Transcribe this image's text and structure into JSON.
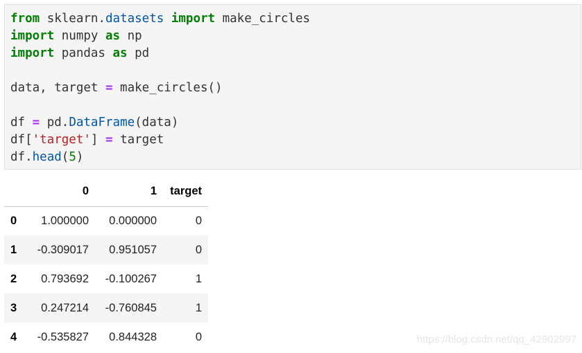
{
  "code_cell": {
    "lines": [
      [
        {
          "t": "from",
          "c": "kw"
        },
        {
          "t": " sklearn",
          "c": ""
        },
        {
          "t": ".",
          "c": ""
        },
        {
          "t": "datasets",
          "c": "nm"
        },
        {
          "t": " ",
          "c": ""
        },
        {
          "t": "import",
          "c": "kw"
        },
        {
          "t": " make_circles",
          "c": ""
        }
      ],
      [
        {
          "t": "import",
          "c": "kw"
        },
        {
          "t": " numpy ",
          "c": ""
        },
        {
          "t": "as",
          "c": "kw"
        },
        {
          "t": " np",
          "c": ""
        }
      ],
      [
        {
          "t": "import",
          "c": "kw"
        },
        {
          "t": " pandas ",
          "c": ""
        },
        {
          "t": "as",
          "c": "kw"
        },
        {
          "t": " pd",
          "c": ""
        }
      ],
      [],
      [
        {
          "t": "data, target ",
          "c": ""
        },
        {
          "t": "=",
          "c": "op"
        },
        {
          "t": " make_circles()",
          "c": ""
        }
      ],
      [],
      [
        {
          "t": "df ",
          "c": ""
        },
        {
          "t": "=",
          "c": "op"
        },
        {
          "t": " pd",
          "c": ""
        },
        {
          "t": ".",
          "c": ""
        },
        {
          "t": "DataFrame",
          "c": "nm"
        },
        {
          "t": "(data)",
          "c": ""
        }
      ],
      [
        {
          "t": "df[",
          "c": ""
        },
        {
          "t": "'target'",
          "c": "st"
        },
        {
          "t": "] ",
          "c": ""
        },
        {
          "t": "=",
          "c": "op"
        },
        {
          "t": " target",
          "c": ""
        }
      ],
      [
        {
          "t": "df",
          "c": ""
        },
        {
          "t": ".",
          "c": ""
        },
        {
          "t": "head",
          "c": "nm"
        },
        {
          "t": "(",
          "c": ""
        },
        {
          "t": "5",
          "c": "nu"
        },
        {
          "t": ")",
          "c": ""
        }
      ]
    ]
  },
  "dataframe": {
    "columns": [
      "0",
      "1",
      "target"
    ],
    "rows": [
      {
        "index": "0",
        "c0": "1.000000",
        "c1": "0.000000",
        "target": "0"
      },
      {
        "index": "1",
        "c0": "-0.309017",
        "c1": "0.951057",
        "target": "0"
      },
      {
        "index": "2",
        "c0": "0.793692",
        "c1": "-0.100267",
        "target": "1"
      },
      {
        "index": "3",
        "c0": "0.247214",
        "c1": "-0.760845",
        "target": "1"
      },
      {
        "index": "4",
        "c0": "-0.535827",
        "c1": "0.844328",
        "target": "0"
      }
    ]
  },
  "watermark": "https://blog.csdn.net/qq_42902997"
}
